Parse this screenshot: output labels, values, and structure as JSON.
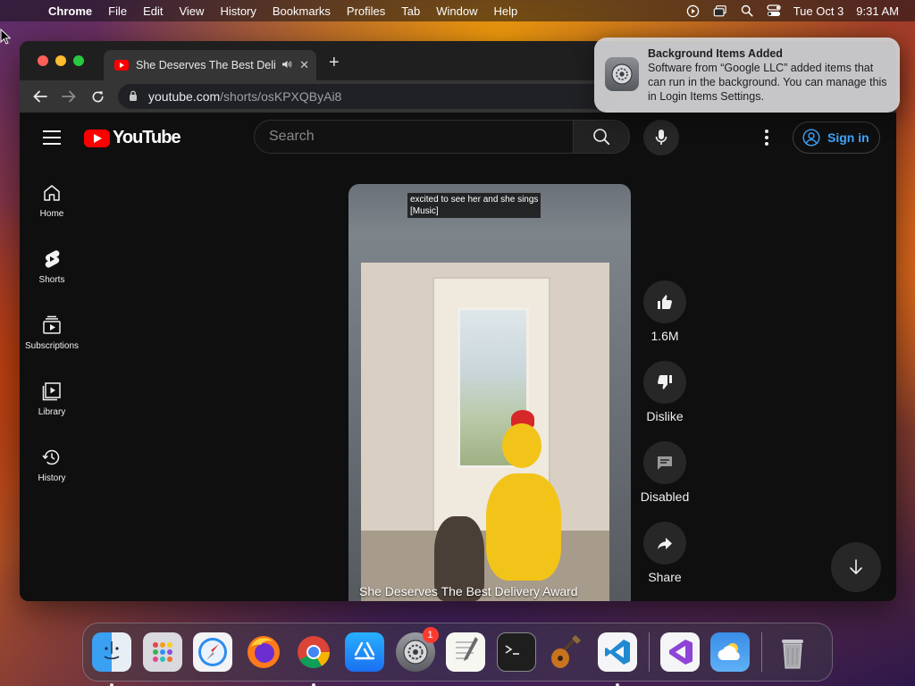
{
  "menubar": {
    "app_name": "Chrome",
    "menus": [
      "File",
      "Edit",
      "View",
      "History",
      "Bookmarks",
      "Profiles",
      "Tab",
      "Window",
      "Help"
    ],
    "date": "Tue Oct 3",
    "time": "9:31 AM"
  },
  "browser": {
    "tab_title": "She Deserves The Best Delivery Award",
    "tab_close": "✕",
    "new_tab": "+",
    "url_host": "youtube.com",
    "url_path": "/shorts/osKPXQByAi8"
  },
  "youtube": {
    "logo_text": "YouTube",
    "search_placeholder": "Search",
    "sign_in": "Sign in",
    "guide": [
      {
        "label": "Home",
        "icon": "home-icon"
      },
      {
        "label": "Shorts",
        "icon": "shorts-icon"
      },
      {
        "label": "Subscriptions",
        "icon": "subscriptions-icon"
      },
      {
        "label": "Library",
        "icon": "library-icon"
      },
      {
        "label": "History",
        "icon": "history-icon"
      }
    ],
    "captions": [
      "excited to see her and she sings",
      "[Music]"
    ],
    "video_title": "She Deserves The Best Delivery Award",
    "actions": {
      "like_count": "1.6M",
      "dislike": "Dislike",
      "comments": "Disabled",
      "share": "Share"
    }
  },
  "notification": {
    "title": "Background Items Added",
    "body": "Software from “Google LLC” added items that can run in the background. You can manage this in Login Items Settings."
  },
  "dock": {
    "apps": [
      "Finder",
      "Launchpad",
      "Safari",
      "Firefox",
      "Chrome",
      "App Store",
      "System Settings",
      "TextEdit",
      "Terminal",
      "Instruments",
      "Visual Studio Code",
      "Visual Studio",
      "Weather",
      "Trash"
    ],
    "settings_badge": "1"
  },
  "colors": {
    "youtube_red": "#ff0000",
    "link_blue": "#3ea6ff",
    "page_bg": "#0f0f0f"
  }
}
